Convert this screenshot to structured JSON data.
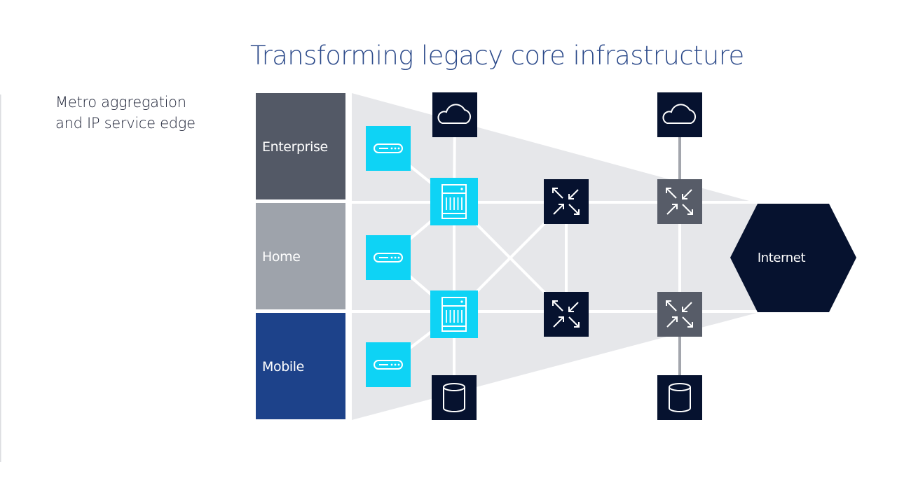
{
  "title": "Transforming legacy core infrastructure",
  "subtitle": [
    "Metro aggregation",
    "and IP service edge"
  ],
  "colors": {
    "title": "#2c4a8a",
    "text": "#1d2236",
    "navy": "#06122f",
    "cyan": "#0ed3f5",
    "slate": "#575c68",
    "fan": "#e6e7ea",
    "link": "#ffffff",
    "link_external": "#a3a6ad",
    "enterprise": "#535966",
    "home": "#9ea3ab",
    "mobile": "#1d428a"
  },
  "segments": [
    {
      "id": "enterprise",
      "label": "Enterprise"
    },
    {
      "id": "home",
      "label": "Home"
    },
    {
      "id": "mobile",
      "label": "Mobile"
    }
  ],
  "nodes": [
    {
      "id": "access-1",
      "type": "access-device",
      "icon": "modem-icon",
      "style": "cyan"
    },
    {
      "id": "access-2",
      "type": "access-device",
      "icon": "modem-icon",
      "style": "cyan"
    },
    {
      "id": "access-3",
      "type": "access-device",
      "icon": "modem-icon",
      "style": "cyan"
    },
    {
      "id": "agg-1",
      "type": "aggregation-router",
      "icon": "chassis-icon",
      "style": "cyan"
    },
    {
      "id": "agg-2",
      "type": "aggregation-router",
      "icon": "chassis-icon",
      "style": "cyan"
    },
    {
      "id": "cloud-1",
      "type": "cloud",
      "icon": "cloud-icon",
      "style": "navy"
    },
    {
      "id": "db-1",
      "type": "database",
      "icon": "database-icon",
      "style": "navy"
    },
    {
      "id": "core-1",
      "type": "core-router",
      "icon": "converge-arrows-icon",
      "style": "navy"
    },
    {
      "id": "core-2",
      "type": "core-router",
      "icon": "converge-arrows-icon",
      "style": "navy"
    },
    {
      "id": "legacy-1",
      "type": "legacy-router",
      "icon": "converge-arrows-icon",
      "style": "slate"
    },
    {
      "id": "legacy-2",
      "type": "legacy-router",
      "icon": "converge-arrows-icon",
      "style": "slate"
    },
    {
      "id": "cloud-2",
      "type": "cloud",
      "icon": "cloud-icon",
      "style": "navy"
    },
    {
      "id": "db-2",
      "type": "database",
      "icon": "database-icon",
      "style": "navy"
    }
  ],
  "internet": {
    "label": "Internet"
  },
  "links": [
    [
      "access-1",
      "agg-1"
    ],
    [
      "access-2",
      "agg-1"
    ],
    [
      "access-2",
      "agg-2"
    ],
    [
      "access-3",
      "agg-2"
    ],
    [
      "cloud-1",
      "agg-1"
    ],
    [
      "agg-1",
      "agg-2"
    ],
    [
      "agg-2",
      "db-1"
    ],
    [
      "agg-1",
      "core-2"
    ],
    [
      "agg-2",
      "core-1"
    ],
    [
      "core-1",
      "core-2"
    ],
    [
      "legacy-1",
      "legacy-2"
    ],
    [
      "cloud-2",
      "legacy-1"
    ],
    [
      "legacy-2",
      "db-2"
    ]
  ]
}
